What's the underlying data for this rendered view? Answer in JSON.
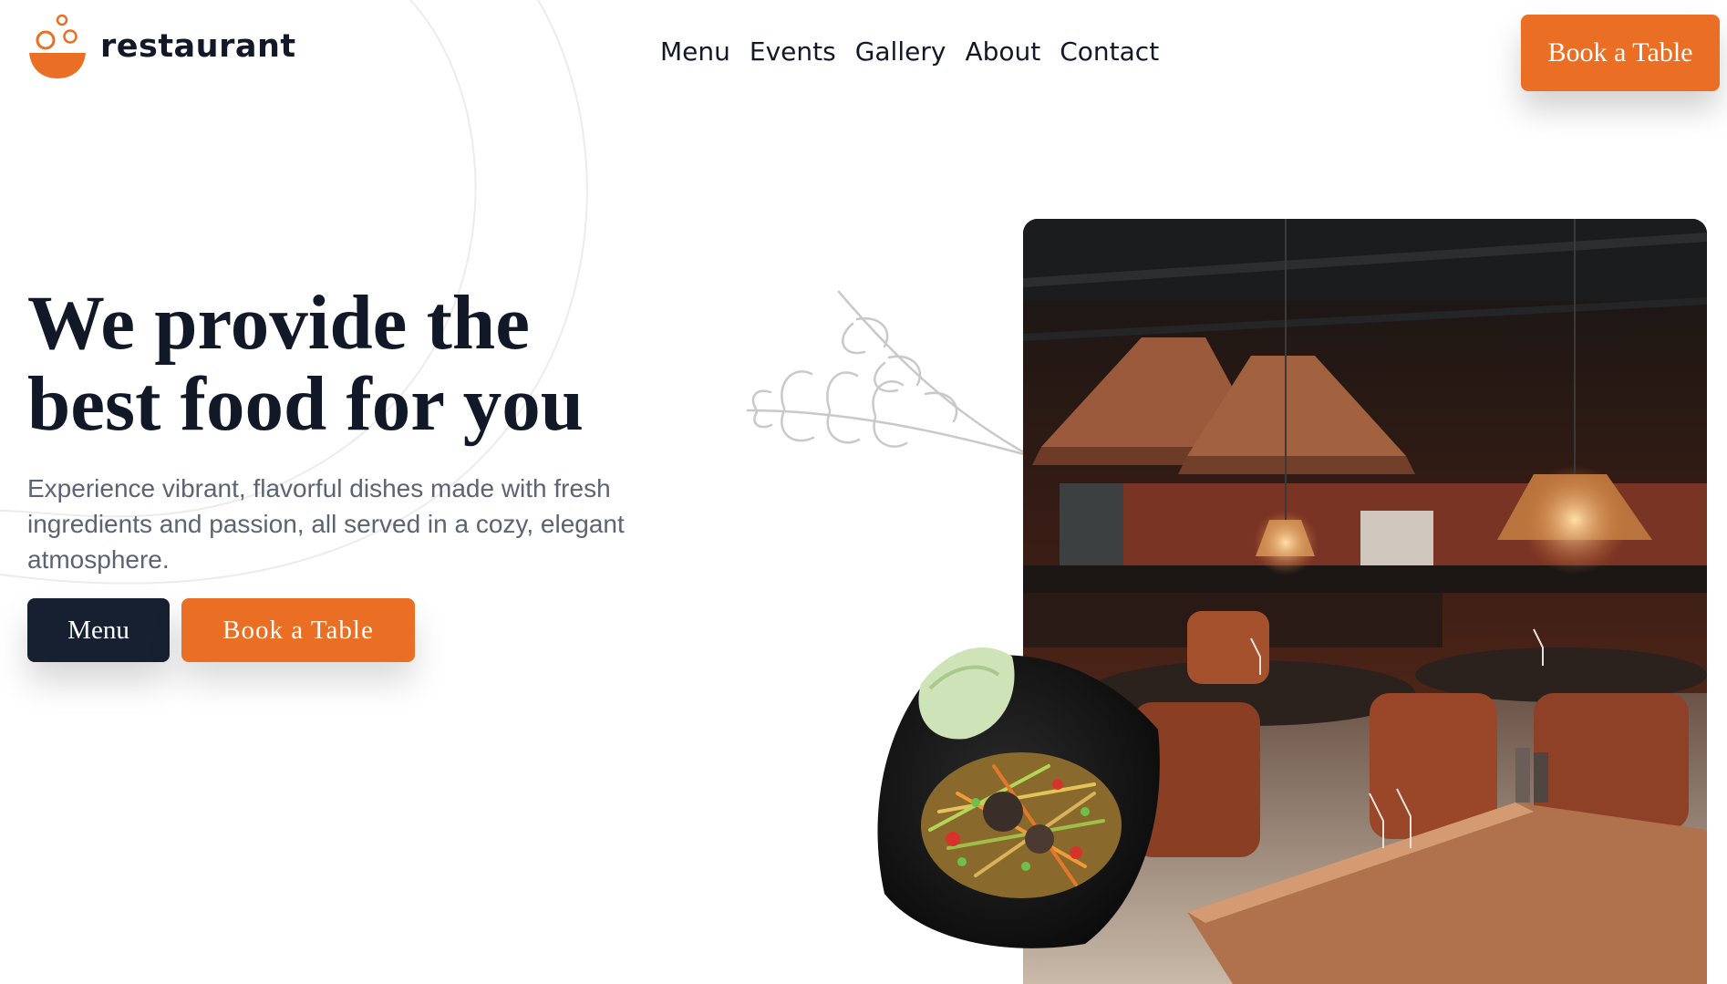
{
  "brand": {
    "name": "restaurant",
    "logo_icon": "bowl-logo-icon",
    "accent_color": "#ea6f25",
    "dark_color": "#172030"
  },
  "nav": {
    "items": [
      "Menu",
      "Events",
      "Gallery",
      "About",
      "Contact"
    ]
  },
  "header": {
    "cta_label": "Book a Table"
  },
  "hero": {
    "title_line1": "We provide the",
    "title_line2": "best food for you",
    "subtitle": "Experience vibrant, flavorful dishes made with fresh ingredients and passion, all served in a cozy, elegant atmosphere.",
    "menu_button": "Menu",
    "book_button": "Book a Table"
  },
  "images": {
    "decoration": "rosemary-sprig",
    "interior": "restaurant-interior-photo",
    "dish": "papaya-salad-dish-photo"
  }
}
